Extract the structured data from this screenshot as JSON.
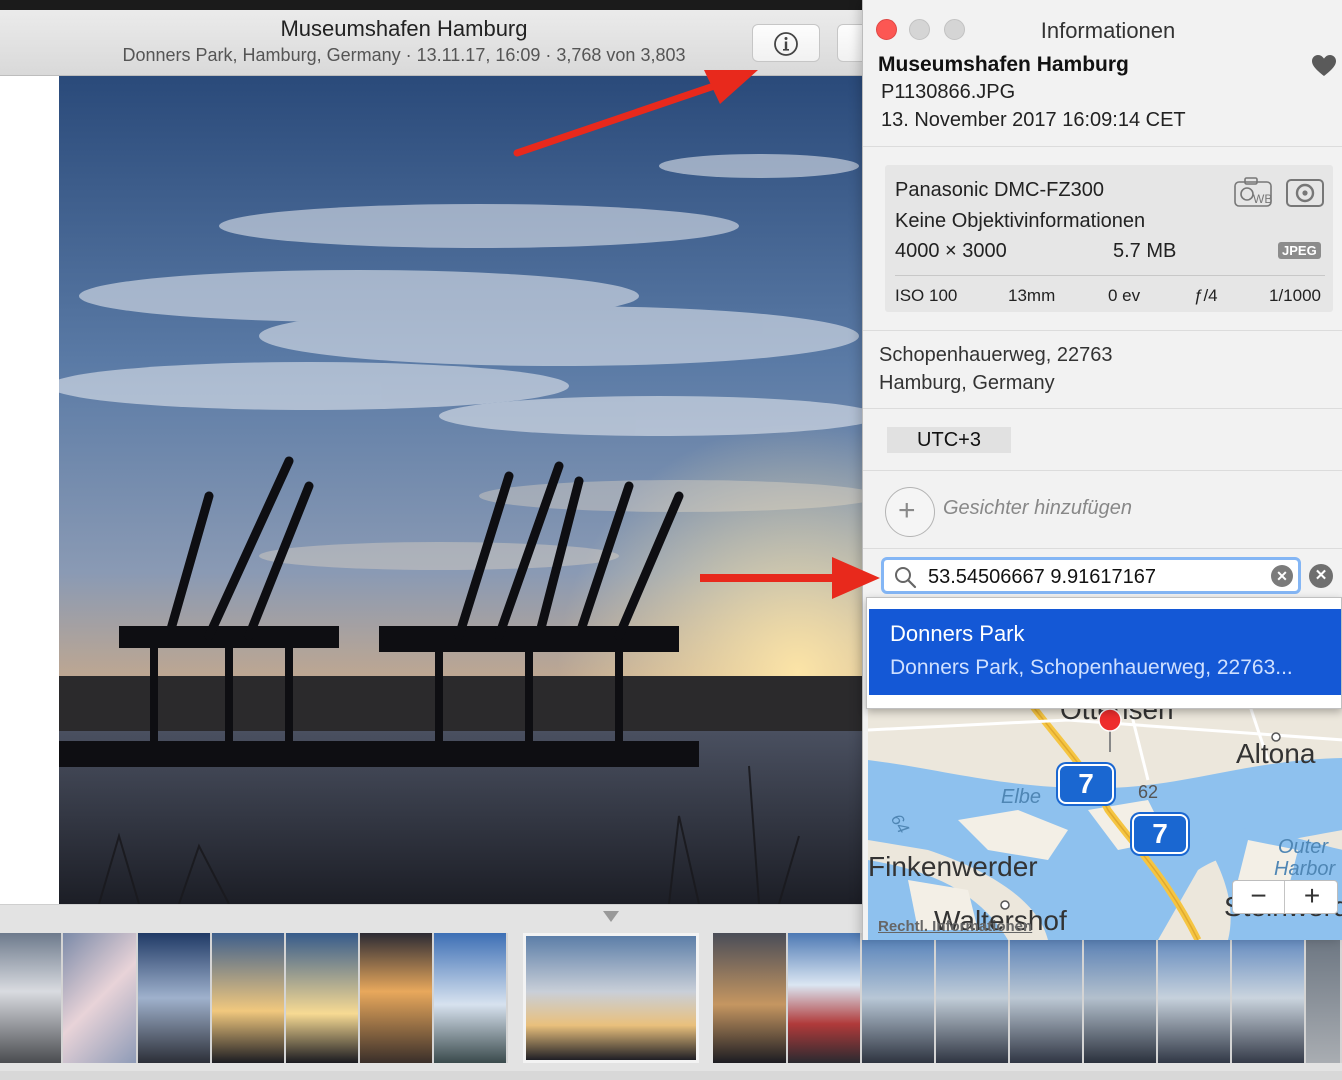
{
  "toolbar": {
    "title": "Museumshafen Hamburg",
    "subtitle": "Donners Park, Hamburg, Germany · 13.11.17, 16:09 · 3,768 von 3,803"
  },
  "info_panel": {
    "window_title": "Informationen",
    "photo_title": "Museumshafen Hamburg",
    "filename": "P1130866.JPG",
    "date_time": "13. November 2017   16:09:14 CET",
    "camera": {
      "model": "Panasonic DMC-FZ300",
      "lens": "Keine Objektivinformationen",
      "dimensions": "4000 × 3000",
      "file_size": "5.7 MB",
      "format_badge": "JPEG",
      "iso": "ISO 100",
      "focal_length": "13mm",
      "exposure_bias": "0 ev",
      "aperture": "ƒ/4",
      "shutter_speed": "1/1000",
      "icons": [
        "white-balance-icon",
        "metering-icon"
      ]
    },
    "address_line1": "Schopenhauerweg, 22763",
    "address_line2": "Hamburg, Germany",
    "timezone": "UTC+3",
    "add_faces_label": "Gesichter hinzufügen",
    "location_search": {
      "value": "53.54506667 9.91617167"
    },
    "suggestion": {
      "title": "Donners Park",
      "subtitle": "Donners Park, Schopenhauerweg, 22763..."
    },
    "map": {
      "labels": {
        "ottensen": "Ottensen",
        "altona": "Altona",
        "elbe": "Elbe",
        "road_62": "62",
        "road_64": "64",
        "finkenwerder": "Finkenwerder",
        "waltershof": "Waltershof",
        "outer": "Outer",
        "harbor": "Harbor",
        "steinwerder": "Steinwerder"
      },
      "route_shield": "7",
      "legal_link": "Rechtl. Informationen",
      "zoom_out": "−",
      "zoom_in": "+"
    }
  },
  "colors": {
    "selection_blue": "#1458d6",
    "annotation_arrow": "#e8291c",
    "close_button": "#fc5753"
  }
}
